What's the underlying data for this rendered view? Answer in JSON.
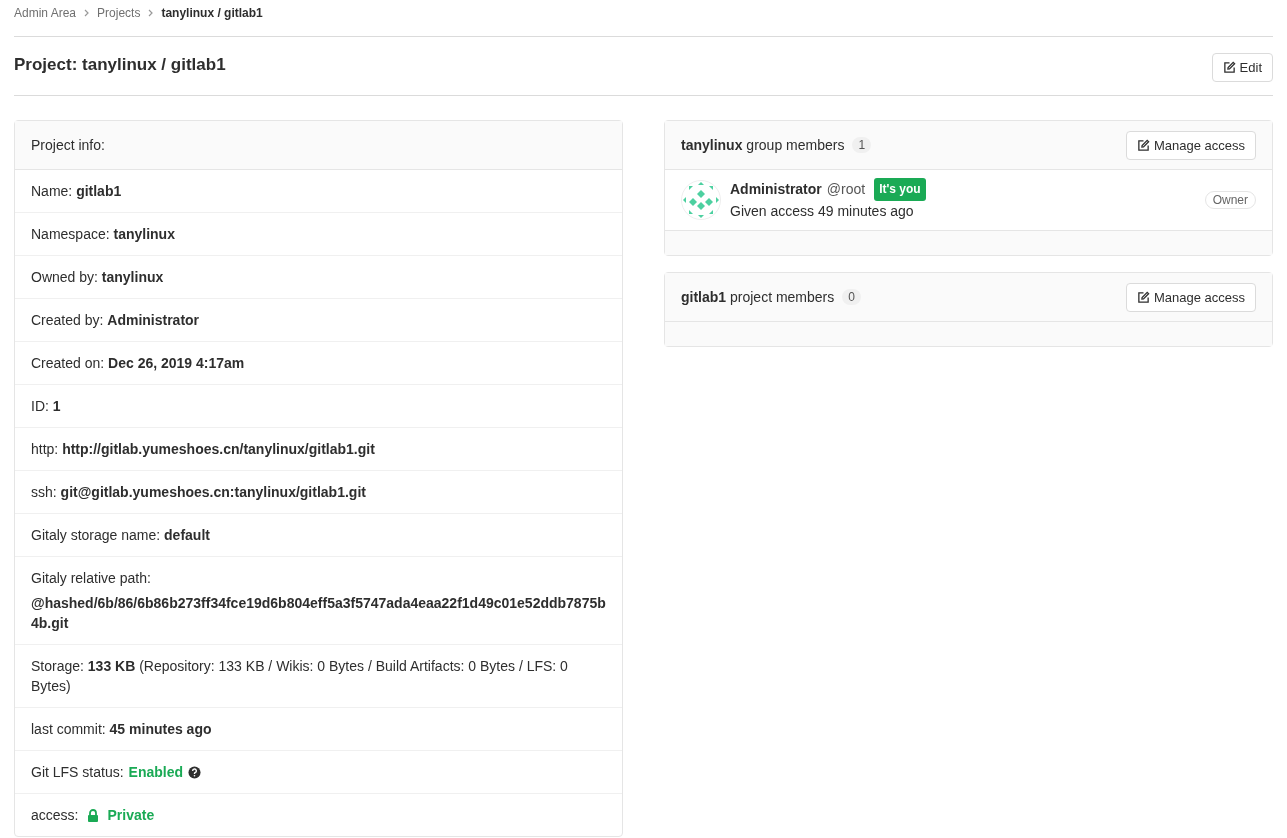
{
  "breadcrumb": [
    {
      "label": "Admin Area",
      "current": false
    },
    {
      "label": "Projects",
      "current": false
    },
    {
      "label": "tanylinux / gitlab1",
      "current": true
    }
  ],
  "title": "Project: tanylinux / gitlab1",
  "edit_button": "Edit",
  "project_info": {
    "heading": "Project info:",
    "rows": [
      {
        "kind": "text",
        "text": "Name: **gitlab1**"
      },
      {
        "kind": "text",
        "text": "Namespace: **tanylinux**"
      },
      {
        "kind": "text",
        "text": "Owned by: **tanylinux**"
      },
      {
        "kind": "text",
        "text": "Created by: **Administrator**"
      },
      {
        "kind": "text",
        "text": "Created on: **Dec 26, 2019 4:17am**"
      },
      {
        "kind": "text",
        "text": "ID: **1**"
      },
      {
        "kind": "text",
        "text": "http: **http://gitlab.yumeshoes.cn/tanylinux/gitlab1.git**"
      },
      {
        "kind": "text",
        "text": "ssh: **git@gitlab.yumeshoes.cn:tanylinux/gitlab1.git**"
      },
      {
        "kind": "text",
        "text": "Gitaly storage name: **default**"
      },
      {
        "kind": "path",
        "label": "Gitaly relative path:",
        "value": "@hashed/6b/86/6b86b273ff34fce19d6b804eff5a3f5747ada4eaa22f1d49c01e52ddb7875b4b.git"
      },
      {
        "kind": "text",
        "text": "Storage: **133 KB** (Repository: 133 KB / Wikis: 0 Bytes / Build Artifacts: 0 Bytes / LFS: 0 Bytes)"
      },
      {
        "kind": "text",
        "text": "last commit: **45 minutes ago**"
      },
      {
        "kind": "status",
        "label": "Git LFS status:",
        "value": "Enabled"
      },
      {
        "kind": "access",
        "label": "access:",
        "value": "Private"
      }
    ]
  },
  "member_panels": [
    {
      "name": "tanylinux",
      "suffix": "group members",
      "count": "1",
      "button": "Manage access",
      "members": [
        {
          "name": "Administrator",
          "username": "@root",
          "badge": "It's you",
          "detail": "Given access 49 minutes ago",
          "role": "Owner"
        }
      ]
    },
    {
      "name": "gitlab1",
      "suffix": "project members",
      "count": "0",
      "button": "Manage access"
    }
  ]
}
